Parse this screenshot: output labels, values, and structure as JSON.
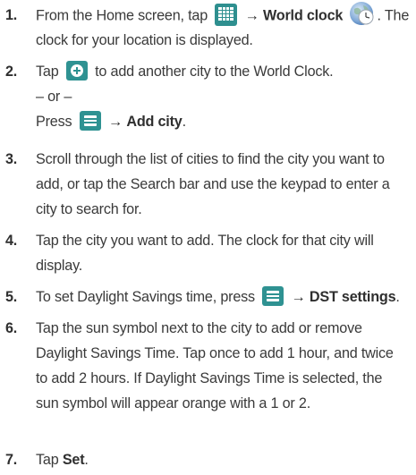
{
  "steps": [
    {
      "num": "1.",
      "line1_a": "From the Home screen, tap",
      "arrow": "→",
      "line1_b": "World clock",
      "line1_c": ". The",
      "line2": "clock for your location is displayed."
    },
    {
      "num": "2.",
      "line1_a": "Tap",
      "line1_b": "to add another city to the World Clock.",
      "or_line": "– or –",
      "press": "Press",
      "arrow": "→",
      "add_city": "Add city",
      "period": "."
    },
    {
      "num": "3.",
      "lines": [
        "Scroll through the list of cities to find the city you want to",
        "add, or tap the Search bar and use the keypad to enter a",
        "city to search for."
      ]
    },
    {
      "num": "4.",
      "lines": [
        "Tap the city you want to add. The clock for that city will",
        "display."
      ]
    },
    {
      "num": "5.",
      "line1_a": "To set Daylight Savings time, press",
      "arrow": "→",
      "line1_b": "DST settings",
      "period": "."
    },
    {
      "num": "6.",
      "lines": [
        "Tap the sun symbol next to the city to add or remove",
        "Daylight Savings Time. Tap once to add 1 hour, and twice",
        "to add 2 hours. If Daylight Savings Time is selected, the",
        "sun symbol will appear orange with a 1 or 2."
      ]
    },
    {
      "num": "7.",
      "tap": "Tap",
      "set": "Set",
      "period": "."
    }
  ],
  "icons": {
    "apps": "apps-grid-icon",
    "world_clock": "world-clock-globe-icon",
    "add": "add-plus-icon",
    "menu": "menu-key-icon"
  },
  "colors": {
    "text": "#3a3a3a",
    "icon_teal": "#2f9292"
  }
}
